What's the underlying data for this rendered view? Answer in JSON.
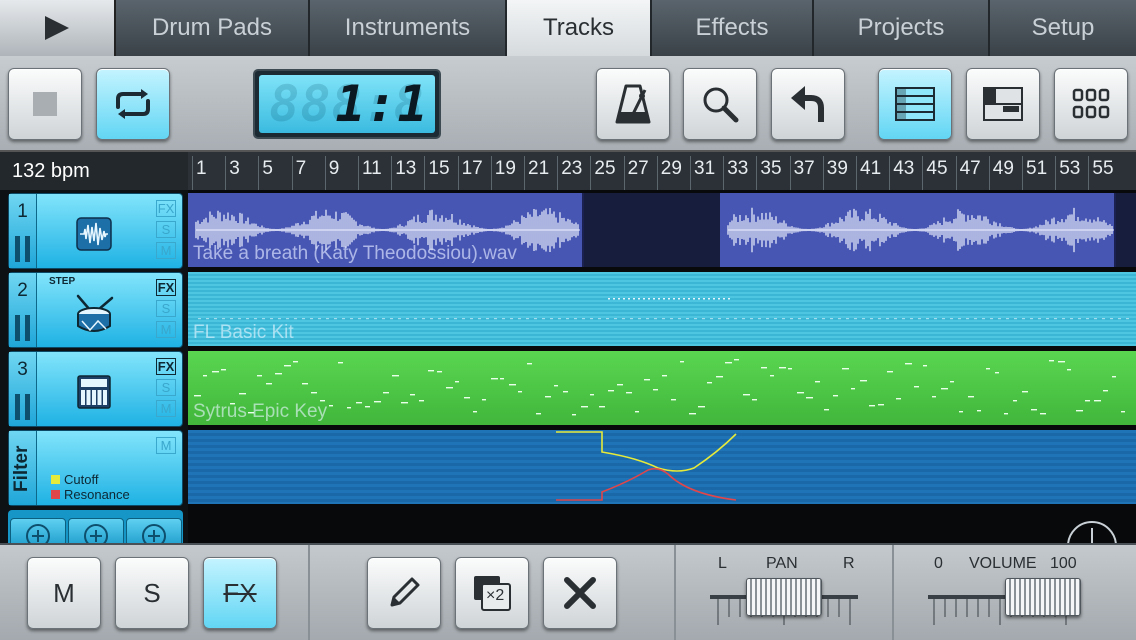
{
  "tabs": {
    "play": "play",
    "items": [
      {
        "label": "Drum Pads"
      },
      {
        "label": "Instruments"
      },
      {
        "label": "Tracks"
      },
      {
        "label": "Effects"
      },
      {
        "label": "Projects"
      },
      {
        "label": "Setup"
      }
    ],
    "active": "Tracks"
  },
  "toolbar": {
    "position_display": "1:1",
    "position_ghost": "888:8"
  },
  "tempo": {
    "bpm_label": "132 bpm"
  },
  "ruler": {
    "ticks": [
      "1",
      "3",
      "5",
      "7",
      "9",
      "11",
      "13",
      "15",
      "17",
      "19",
      "21",
      "23",
      "25",
      "27",
      "29",
      "31",
      "33",
      "35",
      "37",
      "39",
      "41",
      "43",
      "45",
      "47",
      "49",
      "51",
      "53",
      "55"
    ]
  },
  "tracks": [
    {
      "number": "1",
      "name": "Take a breath (Katy Theodossiou).wav",
      "color": "#4a59b8",
      "icon": "waveform-icon"
    },
    {
      "number": "2",
      "name": "FL Basic Kit",
      "step_label": "STEP",
      "color": "#3dbbd8",
      "icon": "drum-icon"
    },
    {
      "number": "3",
      "name": "Sytrus Epic Key",
      "color": "#4fc94b",
      "icon": "keyboard-icon"
    }
  ],
  "automation": {
    "title": "Filter",
    "legend": [
      {
        "name": "Cutoff",
        "color": "#e6ea3a"
      },
      {
        "name": "Resonance",
        "color": "#e0464a"
      }
    ]
  },
  "track_buttons": {
    "fx": "FX",
    "solo": "S",
    "mute": "M"
  },
  "bottom": {
    "mute": "M",
    "solo": "S",
    "fx": "FX",
    "clone_label": "×2",
    "pan": {
      "left": "L",
      "title": "PAN",
      "right": "R",
      "value": 0.5
    },
    "volume": {
      "min": "0",
      "title": "VOLUME",
      "max": "100",
      "value": 0.78
    }
  }
}
